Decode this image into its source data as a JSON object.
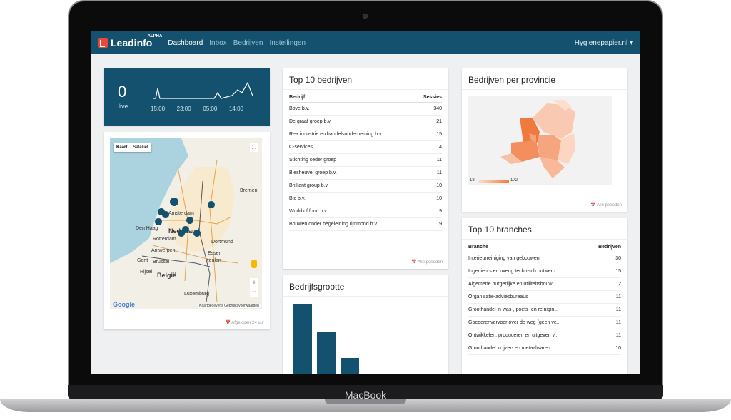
{
  "device": {
    "label": "MacBook"
  },
  "navbar": {
    "brand": "Leadinfo",
    "badge": "ALPHA",
    "links": [
      "Dashboard",
      "Inbox",
      "Bedrijven",
      "Instellingen"
    ],
    "account": "Hygienepapier.nl ▾"
  },
  "live": {
    "count": "0",
    "label": "live",
    "times": [
      "15:00",
      "23:00",
      "05:00",
      "14:00"
    ]
  },
  "map": {
    "toggle": [
      "Kaart",
      "Satelliet"
    ],
    "fullscreen_icon": "⛶",
    "zoom_in": "+",
    "zoom_out": "−",
    "logo": "Google",
    "terms": "Kaartgegevens    Gebruiksvoorwaarden",
    "cities": [
      "Bremen",
      "Den Haag",
      "Amsterdam",
      "Nederland",
      "Rotterdam",
      "Antwerpen",
      "Essen",
      "Dortmund",
      "Keulen",
      "Brussel",
      "Gent",
      "Rijsel",
      "België",
      "Luxemburg"
    ],
    "footer": "📅 Afgelopen 24 uur"
  },
  "top_bedrijven": {
    "title": "Top 10 bedrijven",
    "headers": [
      "Bedrijf",
      "Sessies"
    ],
    "rows": [
      [
        "Bove b.v.",
        "340"
      ],
      [
        "De graaf groep b.v.",
        "21"
      ],
      [
        "Rea industrie en handelsonderneming b.v.",
        "15"
      ],
      [
        "C-services",
        "14"
      ],
      [
        "Stichting ceder groep",
        "11"
      ],
      [
        "Biesheuvel groep b.v.",
        "11"
      ],
      [
        "Brilliant group b.v.",
        "10"
      ],
      [
        "Btc b.v.",
        "10"
      ],
      [
        "World of food b.v.",
        "9"
      ],
      [
        "Bouwen onder begeleiding rijnmond b.v.",
        "9"
      ]
    ],
    "footer": "📅 Alle perioden"
  },
  "provincie": {
    "title": "Bedrijven per provincie",
    "legend_min": "18",
    "legend_max": "172",
    "footer": "📅 Alle perioden"
  },
  "grootte": {
    "title": "Bedrijfsgrootte"
  },
  "branches": {
    "title": "Top 10 branches",
    "headers": [
      "Branche",
      "Bedrijven"
    ],
    "rows": [
      [
        "Interieurreiniging van gebouwen",
        "30"
      ],
      [
        "Ingenieurs en overig technisch ontwerp...",
        "15"
      ],
      [
        "Algemene burgerlijke en utiliteitsbouw",
        "12"
      ],
      [
        "Organisatie-adviesbureaus",
        "11"
      ],
      [
        "Groothandel in was-, poets- en reinigin...",
        "11"
      ],
      [
        "Goederenvervoer over de weg (geen ve...",
        "11"
      ],
      [
        "Ontwikkelen, produceren en uitgeven v...",
        "11"
      ],
      [
        "Groothandel in ijzer- en metaalwaren",
        "10"
      ]
    ]
  },
  "colors": {
    "nav": "#13516e",
    "accent": "#e8493b",
    "choropleth": "#f07a3b"
  }
}
